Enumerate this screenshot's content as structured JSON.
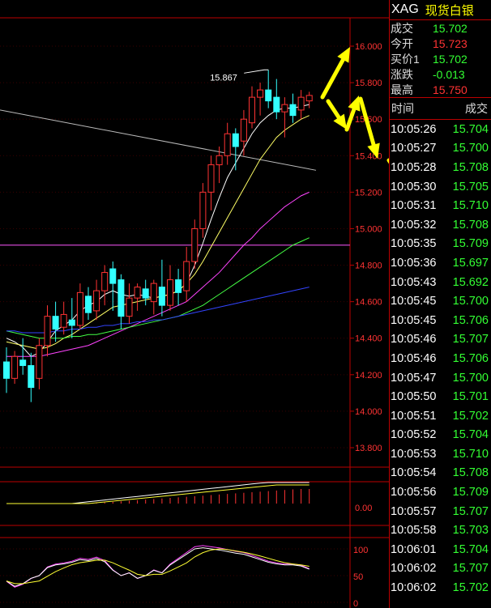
{
  "symbol": {
    "code": "XAG",
    "name": "现货白银"
  },
  "quote": [
    {
      "label": "成交",
      "value": "15.702",
      "color": "green"
    },
    {
      "label": "今开",
      "value": "15.723",
      "color": "red"
    },
    {
      "label": "买价1",
      "value": "15.702",
      "color": "green"
    },
    {
      "label": "涨跌",
      "value": "-0.013",
      "color": "green"
    },
    {
      "label": "最高",
      "value": "15.750",
      "color": "red"
    }
  ],
  "ticks_header": {
    "time": "时间",
    "price": "成交"
  },
  "ticks": [
    {
      "time": "10:05:26",
      "price": "15.704"
    },
    {
      "time": "10:05:27",
      "price": "15.700"
    },
    {
      "time": "10:05:28",
      "price": "15.708"
    },
    {
      "time": "10:05:30",
      "price": "15.705"
    },
    {
      "time": "10:05:31",
      "price": "15.710"
    },
    {
      "time": "10:05:32",
      "price": "15.708"
    },
    {
      "time": "10:05:35",
      "price": "15.709"
    },
    {
      "time": "10:05:36",
      "price": "15.697"
    },
    {
      "time": "10:05:43",
      "price": "15.692"
    },
    {
      "time": "10:05:45",
      "price": "15.700"
    },
    {
      "time": "10:05:45",
      "price": "15.706"
    },
    {
      "time": "10:05:46",
      "price": "15.707"
    },
    {
      "time": "10:05:46",
      "price": "15.706"
    },
    {
      "time": "10:05:47",
      "price": "15.700"
    },
    {
      "time": "10:05:50",
      "price": "15.701"
    },
    {
      "time": "10:05:51",
      "price": "15.702"
    },
    {
      "time": "10:05:52",
      "price": "15.704"
    },
    {
      "time": "10:05:53",
      "price": "15.710"
    },
    {
      "time": "10:05:54",
      "price": "15.708"
    },
    {
      "time": "10:05:56",
      "price": "15.709"
    },
    {
      "time": "10:05:57",
      "price": "15.707"
    },
    {
      "time": "10:05:58",
      "price": "15.703"
    },
    {
      "time": "10:06:01",
      "price": "15.704"
    },
    {
      "time": "10:06:02",
      "price": "15.707"
    },
    {
      "time": "10:06:02",
      "price": "15.702"
    }
  ],
  "chart_data": {
    "type": "candlestick",
    "price_axis": {
      "min": 13.7,
      "max": 16.1,
      "ticks": [
        "16.000",
        "15.800",
        "15.600",
        "15.400",
        "15.200",
        "15.000",
        "14.800",
        "14.600",
        "14.400",
        "14.200",
        "14.000",
        "13.800"
      ]
    },
    "high_annotation": "15.867",
    "candles": [
      {
        "o": 14.27,
        "h": 14.35,
        "l": 14.1,
        "c": 14.18
      },
      {
        "o": 14.18,
        "h": 14.33,
        "l": 14.15,
        "c": 14.3
      },
      {
        "o": 14.28,
        "h": 14.4,
        "l": 14.2,
        "c": 14.25
      },
      {
        "o": 14.25,
        "h": 14.32,
        "l": 14.05,
        "c": 14.13
      },
      {
        "o": 14.18,
        "h": 14.4,
        "l": 14.12,
        "c": 14.36
      },
      {
        "o": 14.36,
        "h": 14.58,
        "l": 14.3,
        "c": 14.52
      },
      {
        "o": 14.52,
        "h": 14.6,
        "l": 14.38,
        "c": 14.45
      },
      {
        "o": 14.46,
        "h": 14.6,
        "l": 14.42,
        "c": 14.53
      },
      {
        "o": 14.5,
        "h": 14.62,
        "l": 14.4,
        "c": 14.47
      },
      {
        "o": 14.47,
        "h": 14.7,
        "l": 14.45,
        "c": 14.65
      },
      {
        "o": 14.63,
        "h": 14.68,
        "l": 14.5,
        "c": 14.54
      },
      {
        "o": 14.55,
        "h": 14.72,
        "l": 14.5,
        "c": 14.66
      },
      {
        "o": 14.66,
        "h": 14.8,
        "l": 14.58,
        "c": 14.76
      },
      {
        "o": 14.78,
        "h": 14.82,
        "l": 14.55,
        "c": 14.7
      },
      {
        "o": 14.72,
        "h": 14.75,
        "l": 14.45,
        "c": 14.52
      },
      {
        "o": 14.52,
        "h": 14.7,
        "l": 14.48,
        "c": 14.62
      },
      {
        "o": 14.62,
        "h": 14.7,
        "l": 14.55,
        "c": 14.68
      },
      {
        "o": 14.67,
        "h": 14.72,
        "l": 14.58,
        "c": 14.62
      },
      {
        "o": 14.6,
        "h": 14.72,
        "l": 14.53,
        "c": 14.7
      },
      {
        "o": 14.68,
        "h": 14.83,
        "l": 14.52,
        "c": 14.58
      },
      {
        "o": 14.58,
        "h": 14.8,
        "l": 14.55,
        "c": 14.72
      },
      {
        "o": 14.72,
        "h": 14.78,
        "l": 14.58,
        "c": 14.65
      },
      {
        "o": 14.66,
        "h": 14.9,
        "l": 14.6,
        "c": 14.82
      },
      {
        "o": 14.82,
        "h": 15.05,
        "l": 14.78,
        "c": 15.0
      },
      {
        "o": 15.0,
        "h": 15.25,
        "l": 14.95,
        "c": 15.2
      },
      {
        "o": 15.2,
        "h": 15.4,
        "l": 15.1,
        "c": 15.35
      },
      {
        "o": 15.35,
        "h": 15.45,
        "l": 15.25,
        "c": 15.4
      },
      {
        "o": 15.4,
        "h": 15.58,
        "l": 15.35,
        "c": 15.52
      },
      {
        "o": 15.52,
        "h": 15.55,
        "l": 15.32,
        "c": 15.45
      },
      {
        "o": 15.48,
        "h": 15.65,
        "l": 15.4,
        "c": 15.6
      },
      {
        "o": 15.58,
        "h": 15.78,
        "l": 15.55,
        "c": 15.72
      },
      {
        "o": 15.72,
        "h": 15.8,
        "l": 15.62,
        "c": 15.76
      },
      {
        "o": 15.76,
        "h": 15.87,
        "l": 15.66,
        "c": 15.7
      },
      {
        "o": 15.72,
        "h": 15.82,
        "l": 15.6,
        "c": 15.64
      },
      {
        "o": 15.64,
        "h": 15.72,
        "l": 15.5,
        "c": 15.68
      },
      {
        "o": 15.68,
        "h": 15.74,
        "l": 15.58,
        "c": 15.62
      },
      {
        "o": 15.65,
        "h": 15.76,
        "l": 15.6,
        "c": 15.72
      },
      {
        "o": 15.7,
        "h": 15.75,
        "l": 15.66,
        "c": 15.73
      }
    ],
    "ma": [
      {
        "color": "#ffffff",
        "values": [
          14.4,
          14.38,
          14.35,
          14.3,
          14.32,
          14.38,
          14.44,
          14.47,
          14.5,
          14.55,
          14.58,
          14.6,
          14.64,
          14.66,
          14.64,
          14.63,
          14.64,
          14.63,
          14.62,
          14.63,
          14.64,
          14.66,
          14.7,
          14.8,
          14.92,
          15.05,
          15.17,
          15.28,
          15.36,
          15.44,
          15.52,
          15.58,
          15.62,
          15.65,
          15.66,
          15.66,
          15.67,
          15.68
        ]
      },
      {
        "color": "#ffff66",
        "values": [
          14.38,
          14.37,
          14.36,
          14.35,
          14.34,
          14.35,
          14.37,
          14.4,
          14.42,
          14.45,
          14.48,
          14.51,
          14.54,
          14.57,
          14.58,
          14.59,
          14.6,
          14.61,
          14.62,
          14.63,
          14.64,
          14.66,
          14.7,
          14.75,
          14.82,
          14.9,
          14.98,
          15.06,
          15.14,
          15.22,
          15.3,
          15.38,
          15.44,
          15.5,
          15.54,
          15.57,
          15.6,
          15.62
        ]
      },
      {
        "color": "#ff44ff",
        "values": [
          14.3,
          14.3,
          14.3,
          14.3,
          14.3,
          14.31,
          14.32,
          14.33,
          14.34,
          14.35,
          14.36,
          14.38,
          14.4,
          14.42,
          14.44,
          14.46,
          14.48,
          14.5,
          14.52,
          14.54,
          14.56,
          14.58,
          14.6,
          14.64,
          14.68,
          14.72,
          14.76,
          14.81,
          14.86,
          14.91,
          14.95,
          15.0,
          15.04,
          15.08,
          15.12,
          15.15,
          15.18,
          15.2
        ]
      },
      {
        "color": "#44ff44",
        "values": [
          14.44,
          14.43,
          14.42,
          14.41,
          14.4,
          14.4,
          14.4,
          14.4,
          14.41,
          14.41,
          14.42,
          14.42,
          14.43,
          14.44,
          14.45,
          14.46,
          14.47,
          14.48,
          14.49,
          14.5,
          14.51,
          14.52,
          14.54,
          14.56,
          14.58,
          14.61,
          14.64,
          14.67,
          14.7,
          14.73,
          14.76,
          14.79,
          14.82,
          14.85,
          14.88,
          14.91,
          14.93,
          14.95
        ]
      },
      {
        "color": "#3344ff",
        "values": [
          14.44,
          14.44,
          14.43,
          14.43,
          14.43,
          14.43,
          14.44,
          14.44,
          14.45,
          14.45,
          14.46,
          14.46,
          14.47,
          14.47,
          14.48,
          14.48,
          14.49,
          14.49,
          14.5,
          14.5,
          14.51,
          14.52,
          14.53,
          14.54,
          14.55,
          14.56,
          14.57,
          14.58,
          14.59,
          14.6,
          14.61,
          14.62,
          14.63,
          14.64,
          14.65,
          14.66,
          14.67,
          14.68
        ]
      }
    ],
    "h_lines": [
      {
        "value": 14.91,
        "color": "#cc44cc"
      }
    ],
    "slow_line": {
      "color": "#bbbbbb",
      "from": 15.65,
      "to": 15.32
    },
    "indicator1": {
      "label": "0.00"
    },
    "indicator2": {
      "ticks": [
        "100",
        "50",
        "0"
      ]
    }
  }
}
